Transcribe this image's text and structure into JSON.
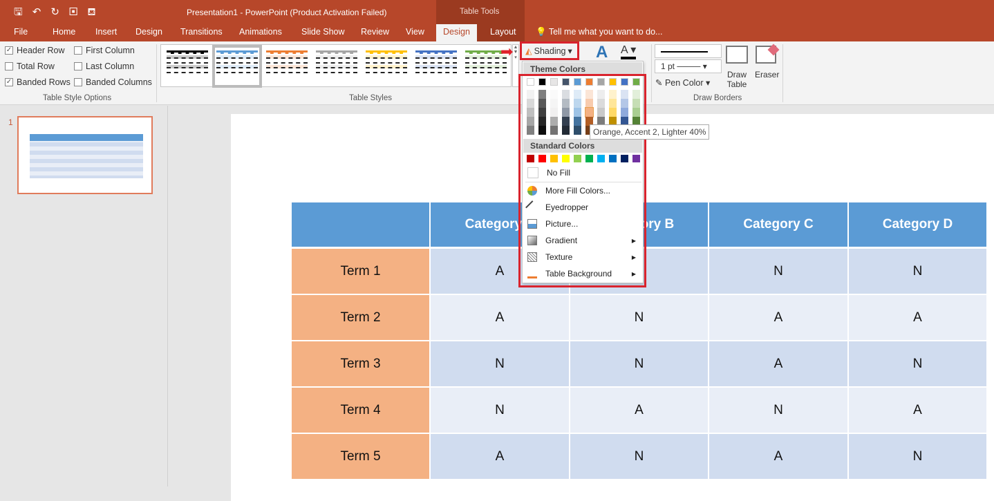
{
  "window": {
    "title": "Presentation1 - PowerPoint (Product Activation Failed)",
    "context_tab": "Table Tools"
  },
  "tabs": [
    "File",
    "Home",
    "Insert",
    "Design",
    "Transitions",
    "Animations",
    "Slide Show",
    "Review",
    "View",
    "Design",
    "Layout"
  ],
  "active_tab": "Design",
  "tell_me": "Tell me what you want to do...",
  "style_options": {
    "items": [
      {
        "label": "Header Row",
        "checked": true
      },
      {
        "label": "First Column",
        "checked": false
      },
      {
        "label": "Total Row",
        "checked": false
      },
      {
        "label": "Last Column",
        "checked": false
      },
      {
        "label": "Banded Rows",
        "checked": true
      },
      {
        "label": "Banded Columns",
        "checked": false
      }
    ],
    "group": "Table Style Options"
  },
  "table_styles": {
    "group": "Table Styles",
    "colors": [
      "#000000",
      "#5b9bd5",
      "#ed7d31",
      "#a5a5a5",
      "#ffc000",
      "#4472c4",
      "#70ad47"
    ]
  },
  "shading": {
    "label": "Shading"
  },
  "draw_borders": {
    "weight": "1 pt",
    "pen_color": "Pen Color",
    "draw_table": "Draw Table",
    "eraser": "Eraser",
    "group": "Draw Borders"
  },
  "menu": {
    "theme_header": "Theme Colors",
    "theme_colors": [
      "#ffffff",
      "#000000",
      "#e7e6e6",
      "#44546a",
      "#5b9bd5",
      "#ed7d31",
      "#a5a5a5",
      "#ffc000",
      "#4472c4",
      "#70ad47"
    ],
    "standard_header": "Standard Colors",
    "standard_colors": [
      "#c00000",
      "#ff0000",
      "#ffc000",
      "#ffff00",
      "#92d050",
      "#00b050",
      "#00b0f0",
      "#0070c0",
      "#002060",
      "#7030a0"
    ],
    "no_fill": "No Fill",
    "items": [
      {
        "label": "More Fill Colors...",
        "icon": "palette-icon"
      },
      {
        "label": "Eyedropper",
        "icon": "eyedropper-icon"
      },
      {
        "label": "Picture...",
        "icon": "picture-icon"
      },
      {
        "label": "Gradient",
        "icon": "gradient-icon",
        "submenu": true
      },
      {
        "label": "Texture",
        "icon": "texture-icon",
        "submenu": true
      },
      {
        "label": "Table Background",
        "icon": "paint-bucket-icon",
        "submenu": true
      }
    ],
    "tooltip": "Orange, Accent 2, Lighter 40%"
  },
  "slide_number": "1",
  "table": {
    "headers": [
      "",
      "Category A",
      "Category B",
      "Category C",
      "Category D"
    ],
    "rows": [
      [
        "Term 1",
        "A",
        "",
        "N",
        "N"
      ],
      [
        "Term 2",
        "A",
        "N",
        "A",
        "A"
      ],
      [
        "Term 3",
        "N",
        "N",
        "A",
        "N"
      ],
      [
        "Term 4",
        "N",
        "A",
        "N",
        "A"
      ],
      [
        "Term 5",
        "A",
        "N",
        "A",
        "N"
      ]
    ],
    "colors": {
      "header": "#5b9bd5",
      "first_col": "#f4b183",
      "band1": "#d0dcef",
      "band2": "#e9eef7"
    }
  }
}
